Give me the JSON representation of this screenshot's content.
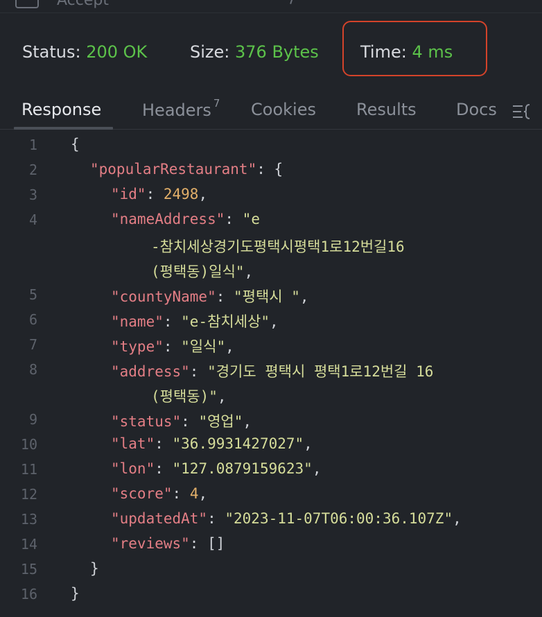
{
  "top_fragment": "Accept",
  "status": {
    "status_label": "Status:",
    "status_value": "200 OK",
    "size_label": "Size:",
    "size_value": "376 Bytes",
    "time_label": "Time:",
    "time_value": "4 ms"
  },
  "tabs": [
    {
      "label": "Response",
      "active": true
    },
    {
      "label": "Headers",
      "count": "7"
    },
    {
      "label": "Cookies"
    },
    {
      "label": "Results"
    },
    {
      "label": "Docs"
    }
  ],
  "response": {
    "line_numbers": [
      "1",
      "2",
      "3",
      "4",
      "5",
      "6",
      "7",
      "8",
      "9",
      "10",
      "11",
      "12",
      "13",
      "14",
      "15",
      "16"
    ],
    "keys": {
      "popularRestaurant": "\"popularRestaurant\"",
      "id": "\"id\"",
      "nameAddress": "\"nameAddress\"",
      "countyName": "\"countyName\"",
      "name": "\"name\"",
      "type": "\"type\"",
      "address": "\"address\"",
      "status": "\"status\"",
      "lat": "\"lat\"",
      "lon": "\"lon\"",
      "score": "\"score\"",
      "updatedAt": "\"updatedAt\"",
      "reviews": "\"reviews\""
    },
    "values": {
      "id": "2498",
      "nameAddress_1": "\"e",
      "nameAddress_2": "-참치세상경기도평택시평택1로12번길16",
      "nameAddress_3": "(평택동)일식\"",
      "countyName": "\"평택시 \"",
      "name": "\"e-참치세상\"",
      "type": "\"일식\"",
      "address_1": "\"경기도 평택시 평택1로12번길 16",
      "address_2": "(평택동)\"",
      "status": "\"영업\"",
      "lat": "\"36.9931427027\"",
      "lon": "\"127.0879159623\"",
      "score": "4",
      "updatedAt": "\"2023-11-07T06:00:36.107Z\"",
      "reviews": "[]"
    }
  }
}
